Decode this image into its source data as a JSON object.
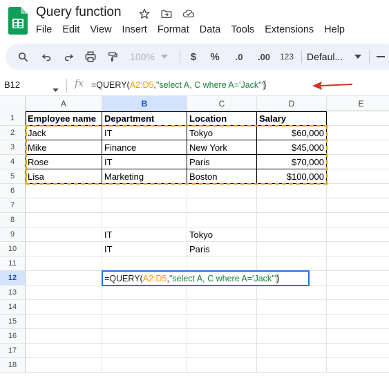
{
  "app": {
    "doc_title": "Query function",
    "menu": [
      "File",
      "Edit",
      "View",
      "Insert",
      "Format",
      "Data",
      "Tools",
      "Extensions",
      "Help"
    ]
  },
  "toolbar": {
    "zoom": "100%",
    "currency": "$",
    "percent": "%",
    "dec_decrease": ".0",
    "dec_increase": ".00",
    "number_format": "123",
    "font": "Defaul..."
  },
  "formula_bar": {
    "cell_ref": "B12",
    "fx": "fx",
    "formula_fn": "=QUERY(",
    "formula_range": "A2:D5",
    "formula_sep": ",",
    "formula_str": "\"select A, C where A='Jack'\"",
    "formula_close": ")"
  },
  "grid": {
    "columns": [
      "A",
      "B",
      "C",
      "D",
      "E"
    ],
    "rows": [
      "1",
      "2",
      "3",
      "4",
      "5",
      "6",
      "7",
      "8",
      "9",
      "10",
      "11",
      "12",
      "13",
      "14",
      "15",
      "16",
      "17",
      "18"
    ],
    "header": [
      "Employee name",
      "Department",
      "Location",
      "Salary"
    ],
    "data": [
      [
        "Jack",
        "IT",
        "Tokyo",
        "$60,000"
      ],
      [
        "Mike",
        "Finance",
        "New York",
        "$45,000"
      ],
      [
        "Rose",
        "IT",
        "Paris",
        "$70,000"
      ],
      [
        "Lisa",
        "Marketing",
        "Boston",
        "$100,000"
      ]
    ],
    "result": [
      [
        "IT",
        "Tokyo"
      ],
      [
        "IT",
        "Paris"
      ]
    ],
    "active_cell": {
      "fn": "=QUERY(",
      "range": "A2:D5",
      "sep": ",",
      "str": "\"select A, C where A='Jack'\"",
      "close": ")"
    }
  },
  "colors": {
    "accent": "#1a73e8",
    "range_highlight": "#f29900",
    "string": "#188038",
    "annotation_arrow": "#d93025",
    "logo_green": "#0f9d58"
  }
}
